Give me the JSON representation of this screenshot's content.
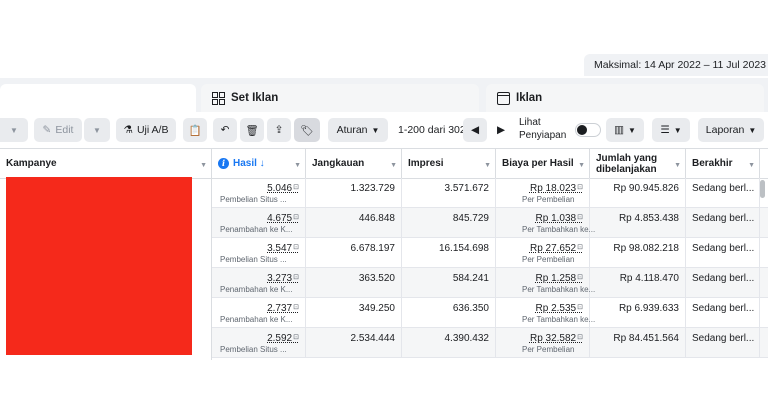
{
  "date_range": {
    "label": "Maksimal: 14 Apr 2022 – 11 Jul 2023"
  },
  "tabs": [
    {
      "label": ""
    },
    {
      "label": "Set Iklan"
    },
    {
      "label": "Iklan"
    }
  ],
  "toolbar": {
    "edit_label": "Edit",
    "ab_label": "Uji A/B",
    "rules_label": "Aturan",
    "pagination": "1-200 dari 302",
    "preview_label_1": "Lihat",
    "preview_label_2": "Penyiapan",
    "report_label": "Laporan"
  },
  "table": {
    "columns": [
      {
        "label": "Kampanye"
      },
      {
        "label": "Hasil ↓"
      },
      {
        "label": "Jangkauan"
      },
      {
        "label": "Impresi"
      },
      {
        "label": "Biaya per Hasil"
      },
      {
        "label": "Jumlah yang dibelanjakan"
      },
      {
        "label": "Berakhir"
      }
    ],
    "rows": [
      {
        "hasil": "5.046",
        "hasil_sub": "Pembelian Situs ...",
        "jangkauan": "1.323.729",
        "impresi": "3.571.672",
        "biaya": "Rp 18.023",
        "biaya_sub": "Per Pembelian",
        "jumlah": "Rp 90.945.826",
        "berakhir": "Sedang berl..."
      },
      {
        "hasil": "4.675",
        "hasil_sub": "Penambahan ke K...",
        "jangkauan": "446.848",
        "impresi": "845.729",
        "biaya": "Rp 1.038",
        "biaya_sub": "Per Tambahkan ke...",
        "jumlah": "Rp 4.853.438",
        "berakhir": "Sedang berl..."
      },
      {
        "hasil": "3.547",
        "hasil_sub": "Pembelian Situs ...",
        "jangkauan": "6.678.197",
        "impresi": "16.154.698",
        "biaya": "Rp 27.652",
        "biaya_sub": "Per Pembelian",
        "jumlah": "Rp 98.082.218",
        "berakhir": "Sedang berl..."
      },
      {
        "hasil": "3.273",
        "hasil_sub": "Penambahan ke K...",
        "jangkauan": "363.520",
        "impresi": "584.241",
        "biaya": "Rp 1.258",
        "biaya_sub": "Per Tambahkan ke...",
        "jumlah": "Rp 4.118.470",
        "berakhir": "Sedang berl..."
      },
      {
        "hasil": "2.737",
        "hasil_sub": "Penambahan ke K...",
        "jangkauan": "349.250",
        "impresi": "636.350",
        "biaya": "Rp 2.535",
        "biaya_sub": "Per Tambahkan ke...",
        "jumlah": "Rp 6.939.633",
        "berakhir": "Sedang berl..."
      },
      {
        "hasil": "2.592",
        "hasil_sub": "Pembelian Situs ...",
        "jangkauan": "2.534.444",
        "impresi": "4.390.432",
        "biaya": "Rp 32.582",
        "biaya_sub": "Per Pembelian",
        "jumlah": "Rp 84.451.564",
        "berakhir": "Sedang berl..."
      }
    ]
  },
  "colors": {
    "accent": "#1877f2",
    "redacted": "#f5291b"
  }
}
